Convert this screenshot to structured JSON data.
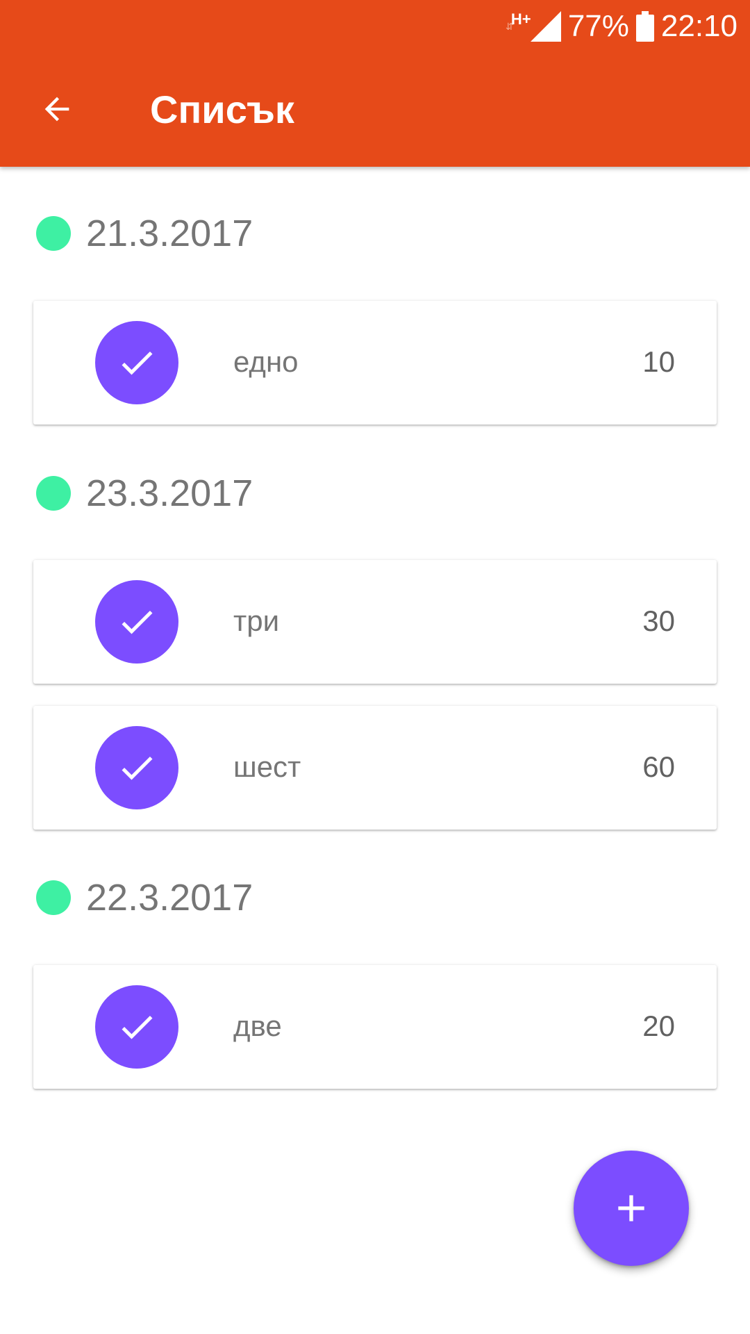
{
  "status_bar": {
    "network_type": "H+",
    "battery_percent": "77%",
    "time": "22:10"
  },
  "app_bar": {
    "title": "Списък",
    "back_icon": "arrow-back-icon"
  },
  "groups": [
    {
      "date": "21.3.2017",
      "items": [
        {
          "name": "едно",
          "value": "10"
        }
      ]
    },
    {
      "date": "23.3.2017",
      "items": [
        {
          "name": "три",
          "value": "30"
        },
        {
          "name": "шест",
          "value": "60"
        }
      ]
    },
    {
      "date": "22.3.2017",
      "items": [
        {
          "name": "две",
          "value": "20"
        }
      ]
    }
  ],
  "fab": {
    "icon": "add-icon"
  },
  "colors": {
    "primary": "#e64a19",
    "accent": "#7c4dff",
    "status_dot": "#3ef0a3",
    "text_secondary": "#757575"
  }
}
